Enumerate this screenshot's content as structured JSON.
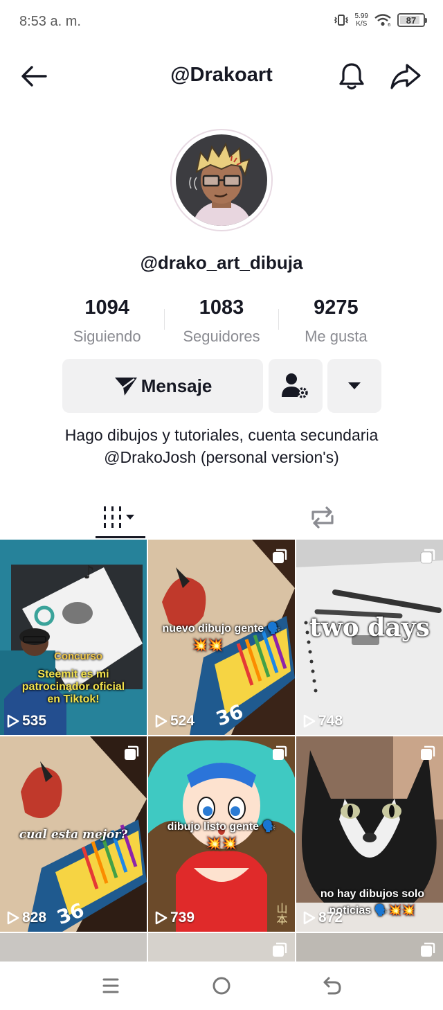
{
  "status_bar": {
    "time": "8:53 a. m.",
    "net_speed": "5.99",
    "net_unit": "K/S",
    "battery": "87",
    "battery_level": 0.87
  },
  "header": {
    "title": "@Drakoart"
  },
  "profile": {
    "username": "@drako_art_dibuja",
    "stats": [
      {
        "value": "1094",
        "label": "Siguiendo"
      },
      {
        "value": "1083",
        "label": "Seguidores"
      },
      {
        "value": "9275",
        "label": "Me gusta"
      }
    ],
    "message_label": "Mensaje",
    "bio": "Hago dibujos y tutoriales, cuenta secundaria @DrakoJosh (personal version's)"
  },
  "icons": {
    "back": "arrow-left-icon",
    "bell": "bell-icon",
    "share": "share-icon",
    "message": "paper-plane-icon",
    "follow_settings": "user-gear-icon",
    "more": "triangle-down-icon",
    "videos_tab": "grid-icon",
    "reposts_tab": "repost-icon",
    "play": "play-icon",
    "multi": "carousel-icon"
  },
  "videos": [
    {
      "views": "535",
      "caption_lines": [
        "Concurso",
        "Steemit es mi",
        "patrocinador oficial",
        "en Tiktok!"
      ],
      "multi": false
    },
    {
      "views": "524",
      "caption": "nuevo dibujo gente 🗣️",
      "emoji": "💥💥",
      "multi": true
    },
    {
      "views": "748",
      "caption": "two days",
      "multi": true
    },
    {
      "views": "828",
      "caption": "cual esta mejor?",
      "multi": true
    },
    {
      "views": "739",
      "caption": "dibujo listo gente 🗣️",
      "emoji": "💥💥",
      "multi": true
    },
    {
      "views": "872",
      "caption": "no hay dibujos solo noticias 🗣️💥💥",
      "multi": true
    }
  ],
  "colors": {
    "text": "#161823",
    "secondary": "#8a8b91",
    "button_bg": "#f1f1f2"
  }
}
